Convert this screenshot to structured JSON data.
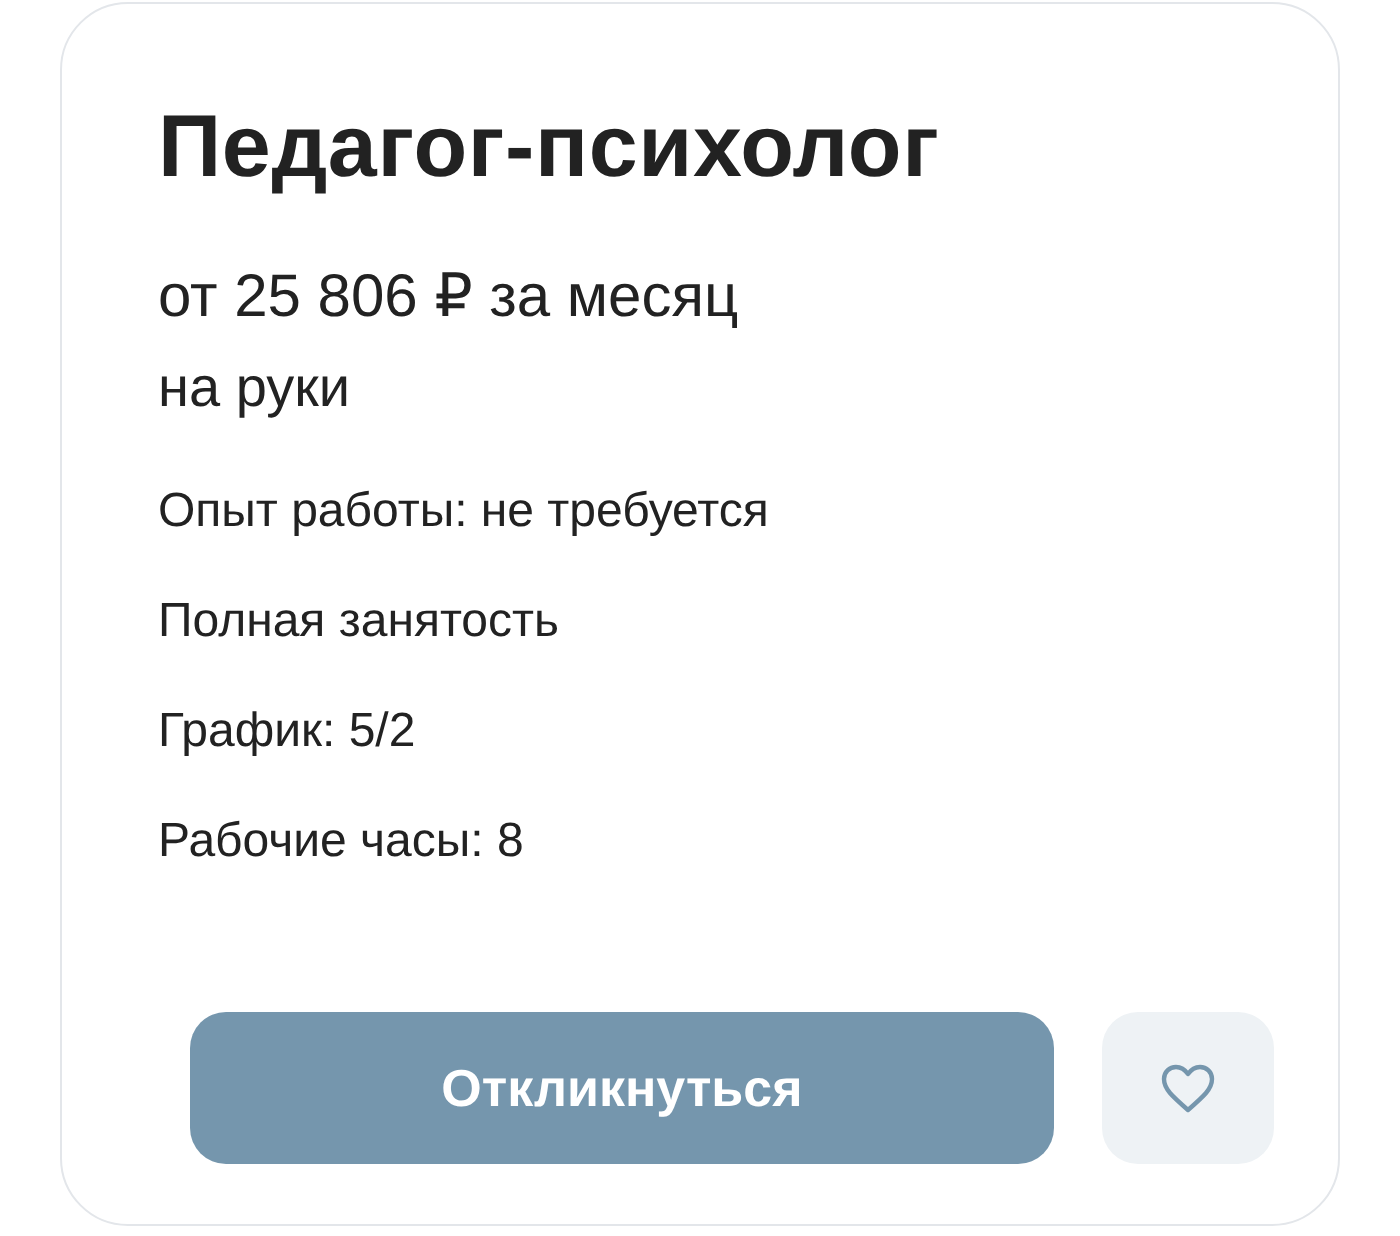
{
  "vacancy": {
    "title": "Педагог-психолог",
    "salary": "от 25 806 ₽ за месяц",
    "salary_note": "на руки",
    "details": [
      "Опыт работы: не требуется",
      "Полная занятость",
      "График: 5/2",
      "Рабочие часы: 8"
    ],
    "apply_button": "Откликнуться",
    "favorite": false
  }
}
